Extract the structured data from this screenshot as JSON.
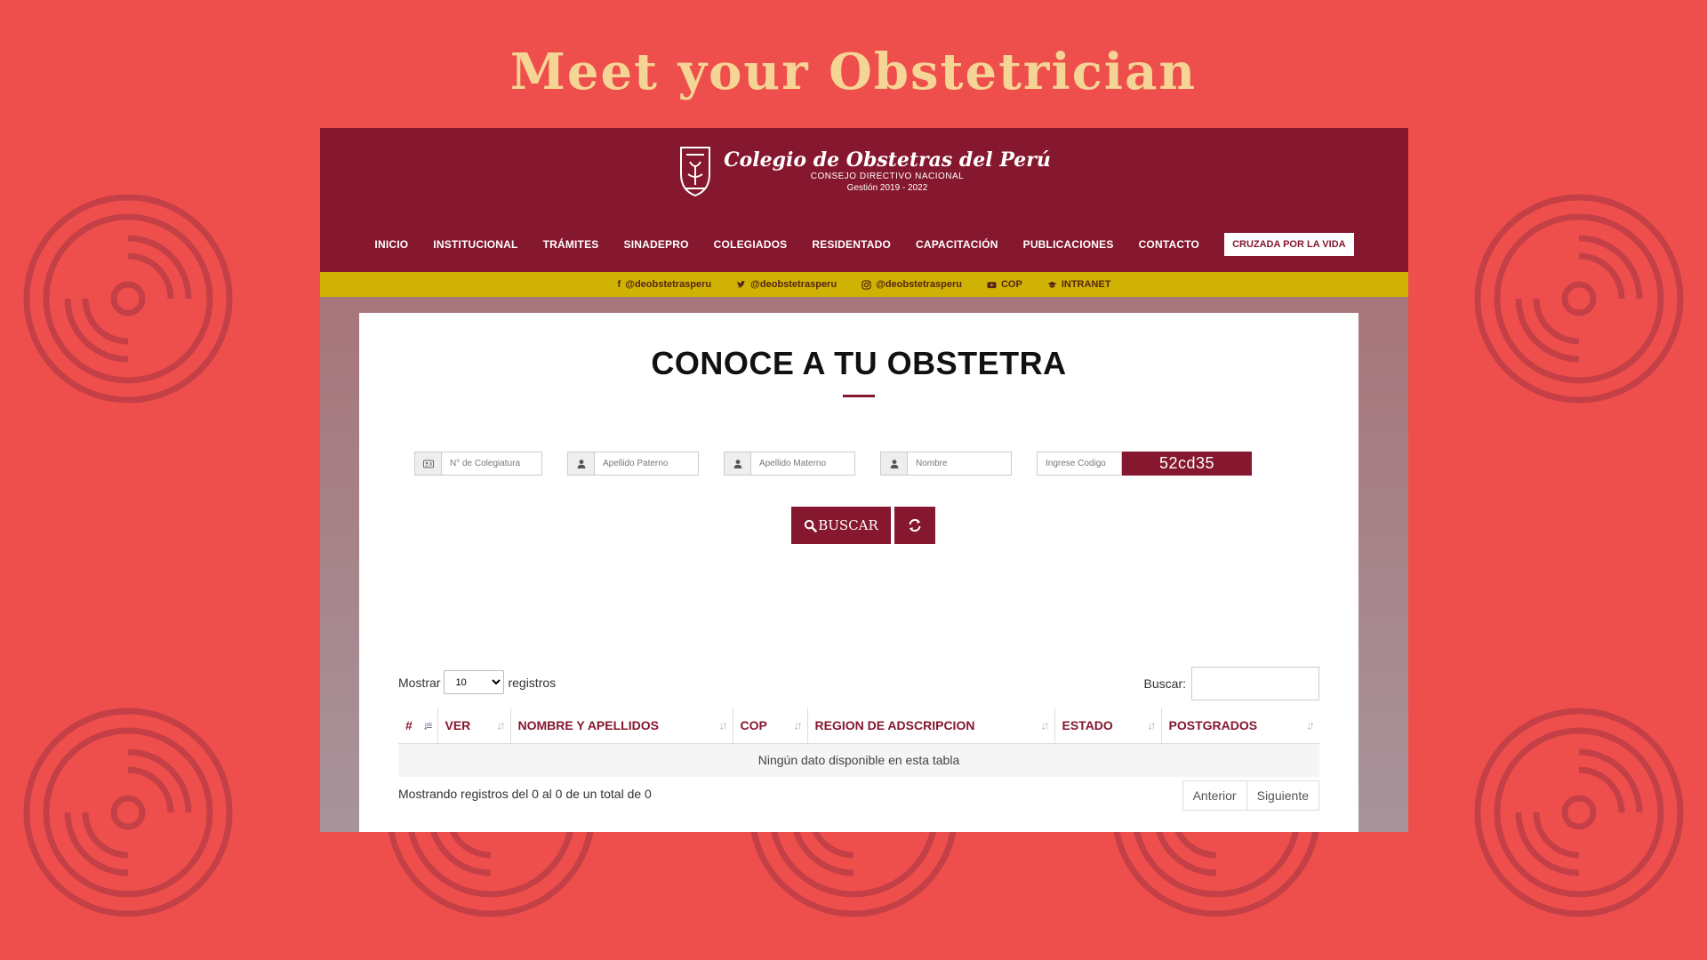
{
  "headline": "Meet your Obstetrician",
  "site": {
    "brand_name": "Colegio de Obstetras del Perú",
    "brand_sub": "CONSEJO DIRECTIVO NACIONAL",
    "brand_gestion": "Gestión 2019 - 2022"
  },
  "nav": {
    "items": [
      "INICIO",
      "INSTITUCIONAL",
      "TRÁMITES",
      "SINADEPRO",
      "COLEGIADOS",
      "RESIDENTADO",
      "CAPACITACIÓN",
      "PUBLICACIONES",
      "CONTACTO"
    ],
    "cta": "CRUZADA POR LA VIDA"
  },
  "social": [
    {
      "icon": "facebook-icon",
      "label": "@deobstetrasperu"
    },
    {
      "icon": "twitter-icon",
      "label": "@deobstetrasperu"
    },
    {
      "icon": "instagram-icon",
      "label": "@deobstetrasperu"
    },
    {
      "icon": "youtube-icon",
      "label": "COP"
    },
    {
      "icon": "graduation-cap-icon",
      "label": "INTRANET"
    }
  ],
  "page": {
    "title": "CONOCE A TU OBSTETRA"
  },
  "search_form": {
    "colegiatura_placeholder": "N° de Colegiatura",
    "apellido_paterno_placeholder": "Apellido Paterno",
    "apellido_materno_placeholder": "Apellido Materno",
    "nombre_placeholder": "Nombre",
    "codigo_placeholder": "Ingrese Codigo",
    "captcha_code": "52cd35",
    "search_label": "BUSCAR"
  },
  "table": {
    "length_label_before": "Mostrar",
    "length_value": "10",
    "length_label_after": "registros",
    "filter_label": "Buscar:",
    "columns": [
      "#",
      "VER",
      "NOMBRE Y APELLIDOS",
      "COP",
      "REGION DE ADSCRIPCION",
      "ESTADO",
      "POSTGRADOS"
    ],
    "empty_message": "Ningún dato disponible en esta tabla",
    "info": "Mostrando registros del 0 al 0 de un total de 0",
    "prev_label": "Anterior",
    "next_label": "Siguiente"
  },
  "colors": {
    "background": "#ef4f4c",
    "headline": "#f5d596",
    "brand": "#85172e",
    "social_bar": "#cfb203"
  }
}
